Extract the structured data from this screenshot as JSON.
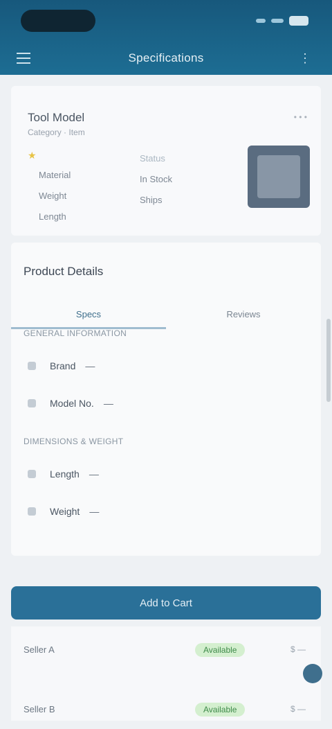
{
  "header": {
    "title": "Specifications"
  },
  "product": {
    "name": "Tool Model",
    "subtitle": "Category · Item",
    "meta": "• • •",
    "star": "★",
    "col1": [
      "Material",
      "Weight",
      "Length"
    ],
    "col2_head": "Status",
    "col2": [
      "In Stock",
      "Ships"
    ]
  },
  "specs": {
    "title": "Product Details",
    "tabs": [
      "Specs",
      "Reviews"
    ],
    "group1": "GENERAL INFORMATION",
    "rows1": [
      {
        "label": "Brand",
        "value": "—"
      },
      {
        "label": "Model No.",
        "value": "—"
      }
    ],
    "group2": "DIMENSIONS & WEIGHT",
    "rows2": [
      {
        "label": "Length",
        "value": "—"
      },
      {
        "label": "Weight",
        "value": "—"
      }
    ]
  },
  "action": {
    "label": "Add to Cart"
  },
  "table": {
    "rows": [
      {
        "name": "Seller A",
        "status": "Available",
        "price": "$ —"
      },
      {
        "name": "Seller B",
        "status": "Available",
        "price": "$ —"
      }
    ]
  },
  "icons": {
    "menu": "menu-icon",
    "more": "more-icon",
    "fab": "chat-icon"
  },
  "colors": {
    "header": "#1d6d93",
    "accent": "#2a7098",
    "status_green": "#3f8b4a"
  }
}
